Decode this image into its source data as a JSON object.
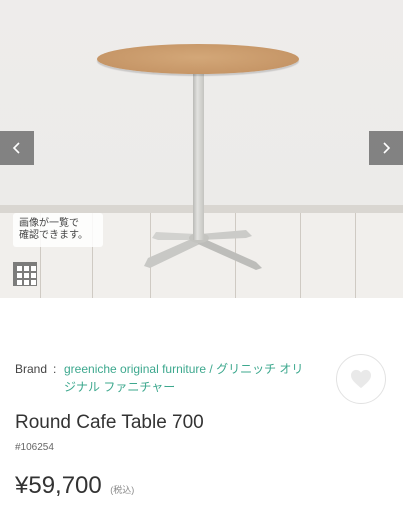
{
  "gallery": {
    "prev_icon": "chevron-left-icon",
    "next_icon": "chevron-right-icon",
    "note": "画像が一覧で\n確認できます。",
    "grid_icon": "grid-icon"
  },
  "product": {
    "brand_label": "Brand",
    "brand_separator": ":",
    "brand_name": "greeniche original furniture / グリニッチ オリジナル ファニチャー",
    "title": "Round Cafe Table 700",
    "code": "#106254",
    "price": "¥59,700",
    "tax_note": "(税込)",
    "favorite_icon": "heart-icon"
  },
  "colors": {
    "brand_link": "#3da88e",
    "wood": "#c69667",
    "overlay": "#5f5f5f"
  }
}
